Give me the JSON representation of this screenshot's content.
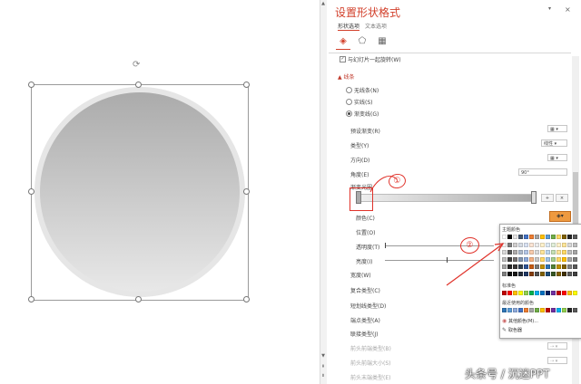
{
  "panel": {
    "title": "设置形状格式",
    "close": "×",
    "pin": "▾",
    "tabs": [
      "形状选项",
      "文本选项"
    ]
  },
  "fill": {
    "collapsed_row": "与幻灯片一起旋转(W)",
    "section_label": "▲ 线条",
    "options": [
      "无线条(N)",
      "实线(S)",
      "渐变线(G)"
    ],
    "selected_option": "渐变线(G)",
    "preset_label": "预设渐变(R)",
    "type_label": "类型(Y)",
    "type_value": "线性",
    "direction_label": "方向(D)",
    "angle_label": "角度(E)",
    "angle_value": "90°",
    "stops_label": "渐变光圈",
    "color_label": "颜色(C)",
    "position_label": "位置(O)",
    "transparency_label": "透明度(T)",
    "brightness_label": "亮度(I)",
    "width_label": "宽度(W)",
    "compound_label": "复合类型(C)",
    "dash_label": "短划线类型(D)",
    "cap_label": "端点类型(A)",
    "join_label": "联接类型(J)",
    "begin_arrow_type": "前头前端类型(B)",
    "begin_arrow_size": "前头前端大小(S)",
    "end_arrow_type": "前头末端类型(E)",
    "add_stop": "+",
    "remove_stop": "×"
  },
  "palette": {
    "theme_title": "主题颜色",
    "standard_title": "标准色",
    "recent_title": "最近使用的颜色",
    "more_colors": "其他颜色(M)...",
    "eyedropper": "取色器",
    "theme_top": [
      "#ffffff",
      "#000000",
      "#e7e6e6",
      "#44546a",
      "#4472c4",
      "#ed7d31",
      "#a5a5a5",
      "#ffc000",
      "#5b9bd5",
      "#70ad47",
      "#ffd966",
      "#7f6000",
      "#262626",
      "#595959"
    ],
    "theme_rows": [
      [
        "#f2f2f2",
        "#7f7f7f",
        "#d0cece",
        "#d6dce4",
        "#d9e2f3",
        "#fbe5d5",
        "#ededed",
        "#fff2cc",
        "#deebf6",
        "#e2efd9",
        "#fff2cc",
        "#ffe699",
        "#d9d9d9",
        "#bfbfbf"
      ],
      [
        "#d9d9d9",
        "#595959",
        "#aeabab",
        "#adb9ca",
        "#b4c6e7",
        "#f7cbac",
        "#dbdbdb",
        "#ffe599",
        "#bdd7ee",
        "#c5e0b3",
        "#ffe599",
        "#ffd966",
        "#bfbfbf",
        "#a6a6a6"
      ],
      [
        "#bfbfbf",
        "#3f3f3f",
        "#757070",
        "#8496b0",
        "#8eaadb",
        "#f4b183",
        "#c9c9c9",
        "#ffd966",
        "#9dc3e6",
        "#a8d08d",
        "#ffd966",
        "#ffc000",
        "#a6a6a6",
        "#7f7f7f"
      ],
      [
        "#a6a6a6",
        "#262626",
        "#3a3838",
        "#323f4f",
        "#2f5496",
        "#c55a11",
        "#7b7b7b",
        "#bf9000",
        "#2e75b5",
        "#538135",
        "#bf9000",
        "#806000",
        "#7f7f7f",
        "#595959"
      ],
      [
        "#7f7f7f",
        "#0d0d0d",
        "#171616",
        "#222a35",
        "#1f3864",
        "#833c0b",
        "#525252",
        "#7f6000",
        "#1e4e79",
        "#375623",
        "#7f6000",
        "#403000",
        "#595959",
        "#404040"
      ]
    ],
    "standard": [
      "#c00000",
      "#ff0000",
      "#ffc000",
      "#ffff00",
      "#92d050",
      "#00b050",
      "#00b0f0",
      "#0070c0",
      "#002060",
      "#7030a0",
      "#c00000",
      "#ff0000",
      "#ffc000",
      "#ffff00"
    ],
    "recent": [
      "#2e75b5",
      "#5b9bd5",
      "#8eaadb",
      "#4472c4",
      "#ed7d31",
      "#a5a5a5",
      "#70ad47",
      "#ffc000",
      "#c00000",
      "#7030a0",
      "#00b0f0",
      "#92d050",
      "#262626",
      "#595959"
    ]
  },
  "annotations": {
    "mark_1": "①",
    "mark_2": "②"
  },
  "watermark": "头条号 / 沉迷PPT"
}
